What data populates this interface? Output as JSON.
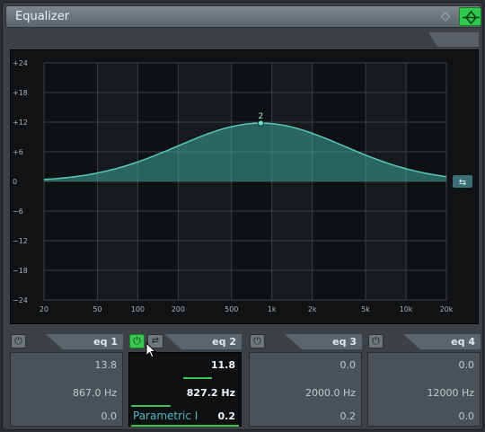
{
  "window": {
    "title": "Equalizer",
    "accent": "#2fc84c"
  },
  "graph": {
    "y_ticks": [
      "+24",
      "+18",
      "+12",
      "+6",
      "0",
      "−6",
      "−12",
      "−18",
      "−24"
    ],
    "x_ticks": [
      "20",
      "50",
      "100",
      "200",
      "500",
      "1k",
      "2k",
      "5k",
      "10k",
      "20k"
    ],
    "node_label": "2",
    "curve_color": "#3ea79b",
    "node": {
      "freq_hz": 827.2,
      "gain_db": 11.8
    },
    "q": 0.2
  },
  "eq": [
    {
      "label": "eq 1",
      "gain": "13.8",
      "freq": "867.0 Hz",
      "q": "0.0",
      "active": false
    },
    {
      "label": "eq 2",
      "gain": "11.8",
      "freq": "827.2 Hz",
      "q": "0.2",
      "mode": "Parametric I",
      "active": true
    },
    {
      "label": "eq 3",
      "gain": "0.0",
      "freq": "2000.0 Hz",
      "q": "0.2",
      "active": false
    },
    {
      "label": "eq 4",
      "gain": "0.0",
      "freq": "12000 Hz",
      "q": "0.0",
      "active": false
    }
  ]
}
